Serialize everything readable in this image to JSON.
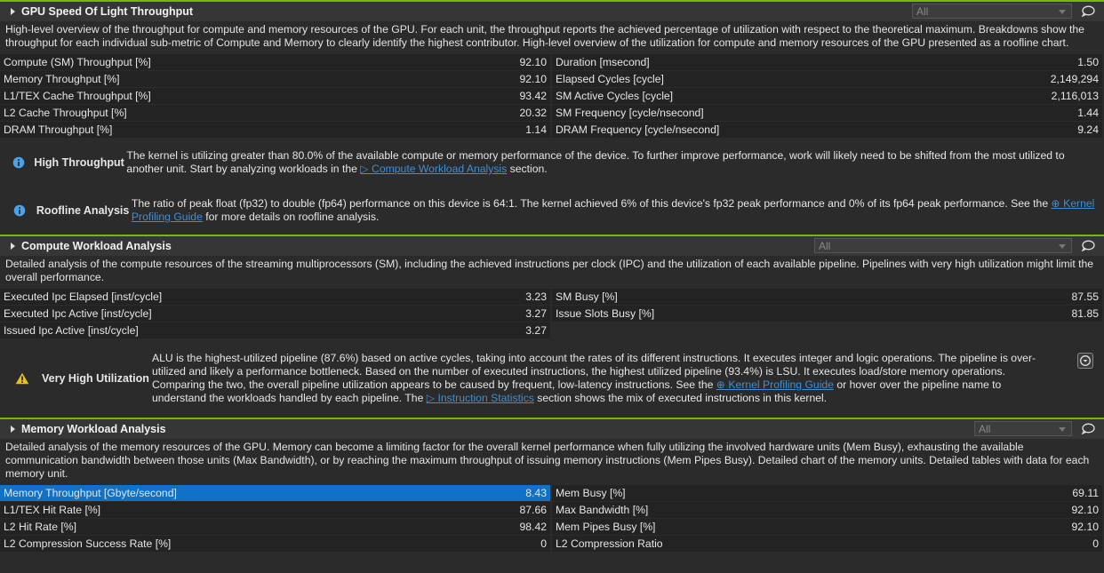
{
  "sections": {
    "sol": {
      "title": "GPU Speed Of Light Throughput",
      "filter": "All",
      "description": "High-level overview of the throughput for compute and memory resources of the GPU. For each unit, the throughput reports the achieved percentage of utilization with respect to the theoretical maximum. Breakdowns show the throughput for each individual sub-metric of Compute and Memory to clearly identify the highest contributor. High-level overview of the utilization for compute and memory resources of the GPU presented as a roofline chart.",
      "left": [
        {
          "name": "Compute (SM) Throughput [%]",
          "value": "92.10"
        },
        {
          "name": "Memory Throughput [%]",
          "value": "92.10"
        },
        {
          "name": "L1/TEX Cache Throughput [%]",
          "value": "93.42"
        },
        {
          "name": "L2 Cache Throughput [%]",
          "value": "20.32"
        },
        {
          "name": "DRAM Throughput [%]",
          "value": "1.14"
        }
      ],
      "right": [
        {
          "name": "Duration [msecond]",
          "value": "1.50"
        },
        {
          "name": "Elapsed Cycles [cycle]",
          "value": "2,149,294"
        },
        {
          "name": "SM Active Cycles [cycle]",
          "value": "2,116,013"
        },
        {
          "name": "SM Frequency [cycle/nsecond]",
          "value": "1.44"
        },
        {
          "name": "DRAM Frequency [cycle/nsecond]",
          "value": "9.24"
        }
      ],
      "rules": [
        {
          "name": "High Throughput",
          "pre": "The kernel is utilizing greater than 80.0% of the available compute or memory performance of the device. To further improve performance, work will likely need to be shifted from the most utilized to another unit. Start by analyzing workloads in the ",
          "link": "Compute Workload Analysis",
          "post": " section."
        },
        {
          "name": "Roofline Analysis",
          "pre": "The ratio of peak float (fp32) to double (fp64) performance on this device is 64:1. The kernel achieved 6% of this device's fp32 peak performance and 0% of its fp64 peak performance. See the ",
          "link": "Kernel Profiling Guide",
          "post": " for more details on roofline analysis."
        }
      ]
    },
    "cwa": {
      "title": "Compute Workload Analysis",
      "filter": "All",
      "description": "Detailed analysis of the compute resources of the streaming multiprocessors (SM), including the achieved instructions per clock (IPC) and the utilization of each available pipeline. Pipelines with very high utilization might limit the overall performance.",
      "left": [
        {
          "name": "Executed Ipc Elapsed [inst/cycle]",
          "value": "3.23"
        },
        {
          "name": "Executed Ipc Active [inst/cycle]",
          "value": "3.27"
        },
        {
          "name": "Issued Ipc Active [inst/cycle]",
          "value": "3.27"
        }
      ],
      "right": [
        {
          "name": "SM Busy [%]",
          "value": "87.55"
        },
        {
          "name": "Issue Slots Busy [%]",
          "value": "81.85"
        }
      ],
      "rule": {
        "name": "Very High Utilization",
        "pre": "ALU is the highest-utilized pipeline (87.6%) based on active cycles, taking into account the rates of its different instructions. It executes integer and logic operations. The pipeline is over-utilized and likely a performance bottleneck. Based on the number of executed instructions, the highest utilized pipeline (93.4%) is LSU. It executes load/store memory operations. Comparing the two, the overall pipeline utilization appears to be caused by frequent, low-latency instructions. See the ",
        "link1": "Kernel Profiling Guide",
        "mid": " or hover over the pipeline name to understand the workloads handled by each pipeline. The ",
        "link2": "Instruction Statistics",
        "post": " section shows the mix of executed instructions in this kernel."
      }
    },
    "mwa": {
      "title": "Memory Workload Analysis",
      "filter": "All",
      "description": "Detailed analysis of the memory resources of the GPU. Memory can become a limiting factor for the overall kernel performance when fully utilizing the involved hardware units (Mem Busy), exhausting the available communication bandwidth between those units (Max Bandwidth), or by reaching the maximum throughput of issuing memory instructions (Mem Pipes Busy). Detailed chart of the memory units. Detailed tables with data for each memory unit.",
      "left": [
        {
          "name": "Memory Throughput [Gbyte/second]",
          "value": "8.43"
        },
        {
          "name": "L1/TEX Hit Rate [%]",
          "value": "87.66"
        },
        {
          "name": "L2 Hit Rate [%]",
          "value": "98.42"
        },
        {
          "name": "L2 Compression Success Rate [%]",
          "value": "0"
        }
      ],
      "right": [
        {
          "name": "Mem Busy [%]",
          "value": "69.11"
        },
        {
          "name": "Max Bandwidth [%]",
          "value": "92.10"
        },
        {
          "name": "Mem Pipes Busy [%]",
          "value": "92.10"
        },
        {
          "name": "L2 Compression Ratio",
          "value": "0"
        }
      ]
    }
  },
  "colors": {
    "accent": "#76b900",
    "selected": "#0e72c9",
    "link": "#3f8ed6",
    "warning": "#e8c21a",
    "info": "#4aa3e8"
  }
}
